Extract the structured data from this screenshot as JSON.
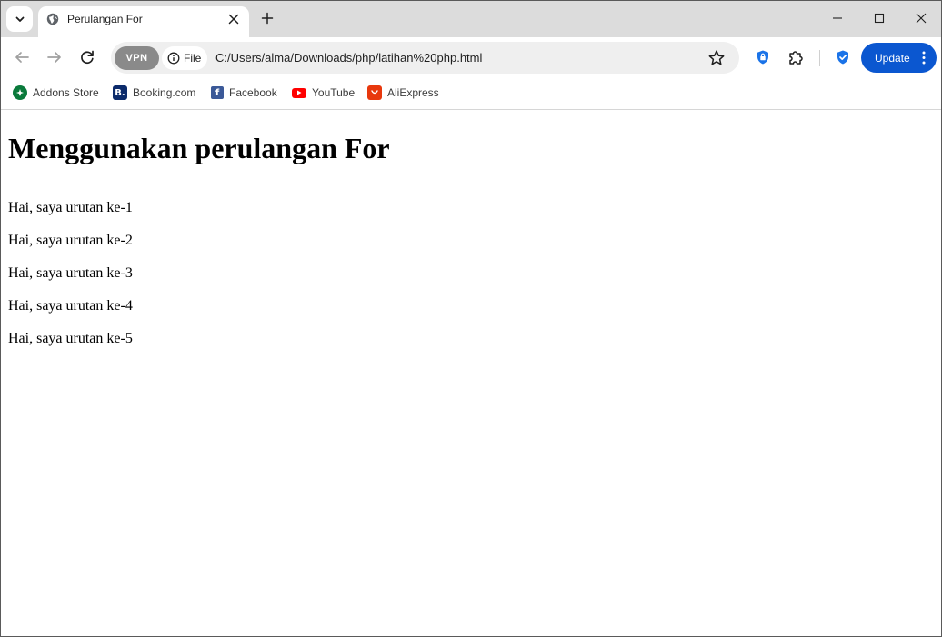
{
  "browser": {
    "tab": {
      "title": "Perulangan For"
    },
    "omnibox": {
      "vpn_label": "VPN",
      "scheme_label": "File",
      "url": "C:/Users/alma/Downloads/php/latihan%20php.html"
    },
    "update_label": "Update",
    "bookmarks": [
      {
        "label": "Addons Store",
        "icon": "addons-store-icon",
        "color": "#0a7a3b"
      },
      {
        "label": "Booking.com",
        "icon": "booking-icon",
        "color": "#0c2b6b"
      },
      {
        "label": "Facebook",
        "icon": "facebook-icon",
        "color": "#3b5998"
      },
      {
        "label": "YouTube",
        "icon": "youtube-icon",
        "color": "#ff0000"
      },
      {
        "label": "AliExpress",
        "icon": "aliexpress-icon",
        "color": "#e8380d"
      }
    ],
    "accent_color": "#0b57d0"
  },
  "page": {
    "heading": "Menggunakan perulangan For",
    "lines": [
      "Hai, saya urutan ke-1",
      "Hai, saya urutan ke-2",
      "Hai, saya urutan ke-3",
      "Hai, saya urutan ke-4",
      "Hai, saya urutan ke-5"
    ]
  }
}
